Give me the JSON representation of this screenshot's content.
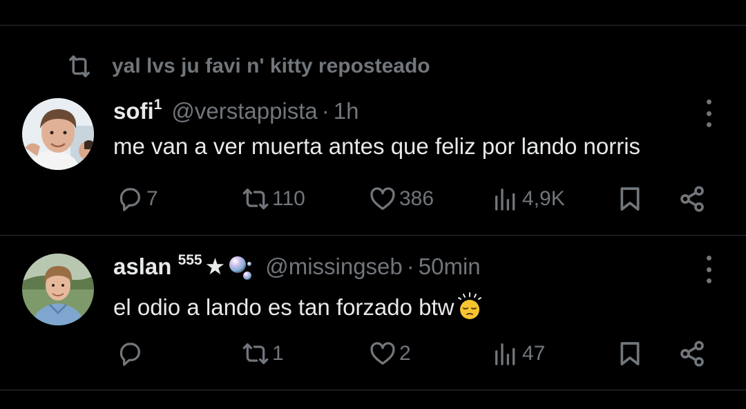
{
  "colors": {
    "background": "#000000",
    "text_primary": "#e7e9ea",
    "text_secondary": "#71767b",
    "divider": "#2f3336"
  },
  "repost_banner": {
    "icon": "repost-icon",
    "text": "yal lvs ju favi n' kitty reposteado"
  },
  "tweets": [
    {
      "display_name": "sofi",
      "name_superscript": "1",
      "handle": "@verstappista",
      "separator": "·",
      "time": "1h",
      "text": "me van a ver muerta antes que feliz por lando norris",
      "replies": "7",
      "reposts": "110",
      "likes": "386",
      "views": "4,9K"
    },
    {
      "display_name": "aslan",
      "name_superscript": "555",
      "name_suffix": "★",
      "handle": "@missingseb",
      "separator": "·",
      "time": "50min",
      "text": "el odio a lando es tan forzado btw",
      "replies": "",
      "reposts": "1",
      "likes": "2",
      "views": "47"
    }
  ]
}
